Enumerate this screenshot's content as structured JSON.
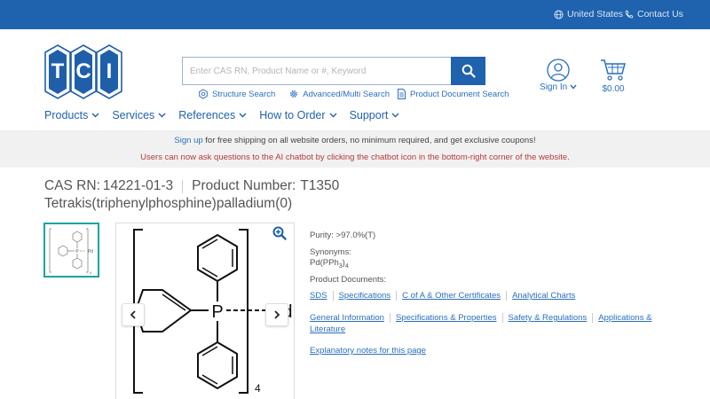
{
  "topbar": {
    "region": "United States",
    "contact": "Contact Us",
    "icons": [
      "globe-icon",
      "phone-icon"
    ]
  },
  "logo": {
    "letters": [
      "T",
      "C",
      "I"
    ]
  },
  "search": {
    "placeholder": "Enter CAS RN, Product Name or #, Keyword",
    "links": [
      "Structure Search",
      "Advanced/Multi Search",
      "Product Document Search"
    ]
  },
  "account": {
    "signin_label": "Sign In"
  },
  "cart": {
    "total": "$0.00"
  },
  "nav": [
    "Products",
    "Services",
    "References",
    "How to Order",
    "Support"
  ],
  "promo": {
    "signup_link": "Sign up",
    "line1_rest": "for free shipping on all website orders, no minimum required, and get exclusive coupons!",
    "line2": "Users can now ask questions to the AI chatbot by clicking the chatbot icon in the bottom-right corner of the website."
  },
  "product": {
    "cas_label": "CAS RN:",
    "cas": "14221-01-3",
    "number_label": "Product Number:",
    "number": "T1350",
    "name": "Tetrakis(triphenylphosphine)palladium(0)",
    "structure": {
      "atom_p": "P",
      "atom_pd": "Pd",
      "subscript": "4"
    }
  },
  "details": {
    "purity": "Purity: >97.0%(T)",
    "synonyms_label": "Synonyms:",
    "synonym_main": "Pd(PPh",
    "synonym_sub1": "3",
    "synonym_close": ")",
    "synonym_sub2": "4",
    "docs_label": "Product Documents:",
    "docs_row1": [
      "SDS",
      "Specifications",
      "C of A & Other Certificates",
      "Analytical Charts"
    ],
    "docs_row2": [
      "General Information",
      "Specifications & Properties",
      "Safety & Regulations",
      "Applications &"
    ],
    "docs_row2_cont": "Literature",
    "explanatory": "Explanatory notes for this page"
  }
}
